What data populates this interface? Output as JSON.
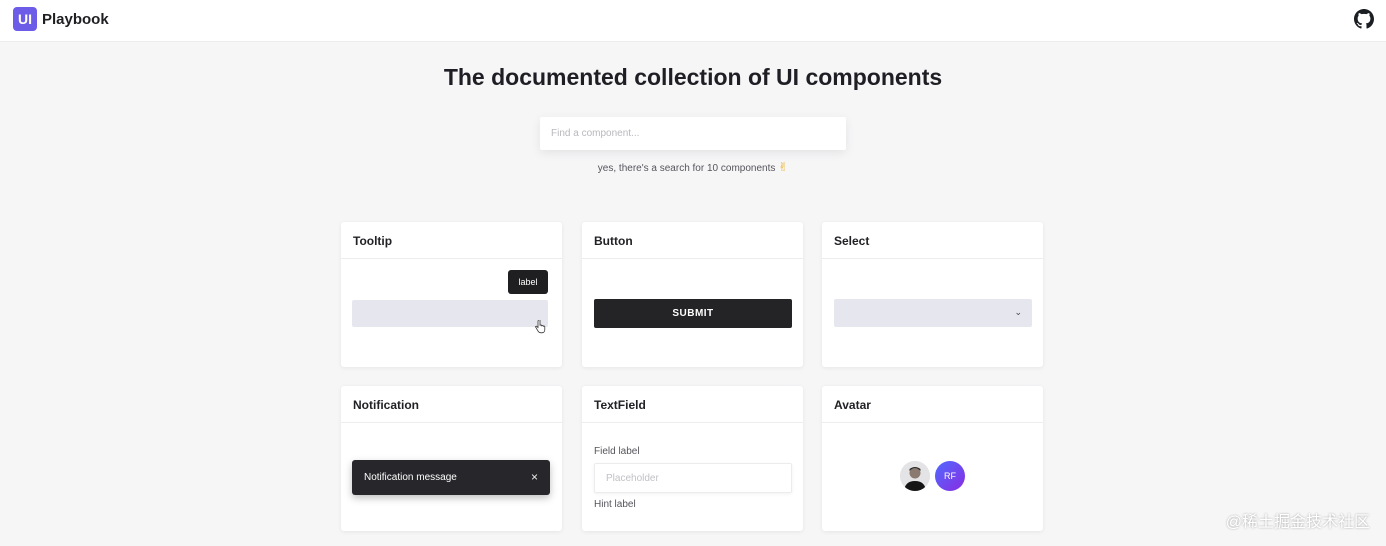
{
  "header": {
    "logo_badge": "UI",
    "logo_text": "Playbook",
    "github_icon": "github-icon"
  },
  "hero": {
    "title": "The documented collection of UI components",
    "search_placeholder": "Find a component...",
    "search_hint": "yes, there's a search for 10 components",
    "search_hint_emoji": "✌"
  },
  "cards": {
    "tooltip": {
      "title": "Tooltip",
      "tooltip_label": "label"
    },
    "button": {
      "title": "Button",
      "button_label": "SUBMIT"
    },
    "select": {
      "title": "Select",
      "chevron": "⌄"
    },
    "notification": {
      "title": "Notification",
      "message": "Notification message",
      "close": "×"
    },
    "textfield": {
      "title": "TextField",
      "field_label": "Field label",
      "placeholder": "Placeholder",
      "hint": "Hint label"
    },
    "avatar": {
      "title": "Avatar",
      "initials": "RF"
    }
  },
  "watermark": "@稀土掘金技术社区",
  "colors": {
    "brand": "#6c5ce7",
    "dark": "#242426",
    "avatar_gradient_start": "#4f6bff",
    "avatar_gradient_end": "#8a2be2"
  }
}
